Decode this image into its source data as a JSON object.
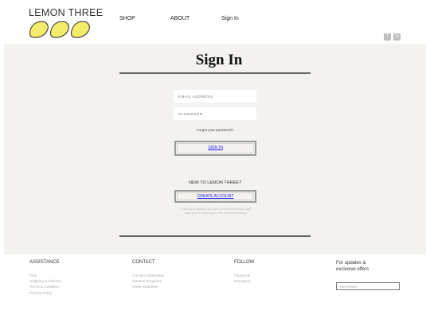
{
  "header": {
    "logo_text": "LEMON THREE",
    "nav": [
      "SHOP",
      "ABOUT",
      "Sign In"
    ],
    "social": [
      {
        "icon": "facebook-icon",
        "glyph": "f"
      },
      {
        "icon": "instagram-icon",
        "glyph": "◎"
      }
    ]
  },
  "signin": {
    "title": "Sign In",
    "email_placeholder": "EMAIL ADDRESS",
    "password_placeholder": "PASSWORD",
    "forgot_link": "Forgot your password?",
    "signin_button": "SIGN IN",
    "new_heading": "NEW TO LEMON THREE?",
    "create_button": "CREATE ACCOUNT",
    "blurb": "Creating an account will save you time at checkout and allow you to access your order status and history."
  },
  "footer": {
    "assistance": {
      "heading": "ASSISTANCE",
      "links": [
        "FAQ",
        "Shipping & Delivery",
        "Terms & Condition",
        "Privacy Policy"
      ]
    },
    "contact": {
      "heading": "CONTACT",
      "links": [
        "Contact Information",
        "General Enquiries",
        "Order Enquiries"
      ]
    },
    "follow": {
      "heading": "FOLLOW",
      "links": [
        "Facebook",
        "Instagram"
      ]
    },
    "newsletter": {
      "heading": "For updates & exclusive offers",
      "email_placeholder": "Your Email"
    }
  },
  "colors": {
    "lemon": "#f3ec6c",
    "lemon_outline": "#2b2b2b",
    "panel": "#f4f2ef",
    "link_blue": "#1a1aee"
  }
}
